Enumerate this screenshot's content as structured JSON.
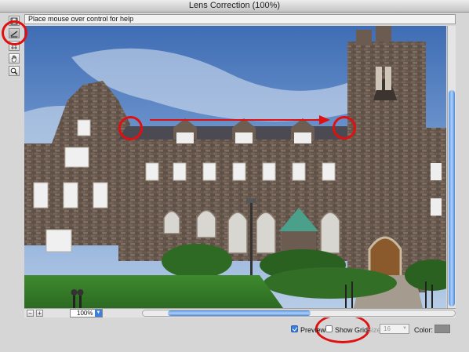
{
  "window": {
    "title": "Lens Correction (100%)"
  },
  "help": {
    "text": "Place mouse over control for help"
  },
  "tools": [
    {
      "name": "remove-distortion-tool-icon"
    },
    {
      "name": "straighten-tool-icon"
    },
    {
      "name": "move-grid-tool-icon"
    },
    {
      "name": "hand-tool-icon"
    },
    {
      "name": "zoom-tool-icon"
    }
  ],
  "zoom": {
    "value": "100%",
    "minus": "−",
    "plus": "+"
  },
  "options": {
    "preview_label": "Preview",
    "preview_checked": true,
    "show_grid_label": "Show Grid",
    "show_grid_checked": false,
    "size_label": "Size:",
    "size_value": "16",
    "color_label": "Color:",
    "grid_color": "#8a8a8a"
  },
  "colors": {
    "annotation": "#e01010",
    "accent": "#3a7de0"
  }
}
